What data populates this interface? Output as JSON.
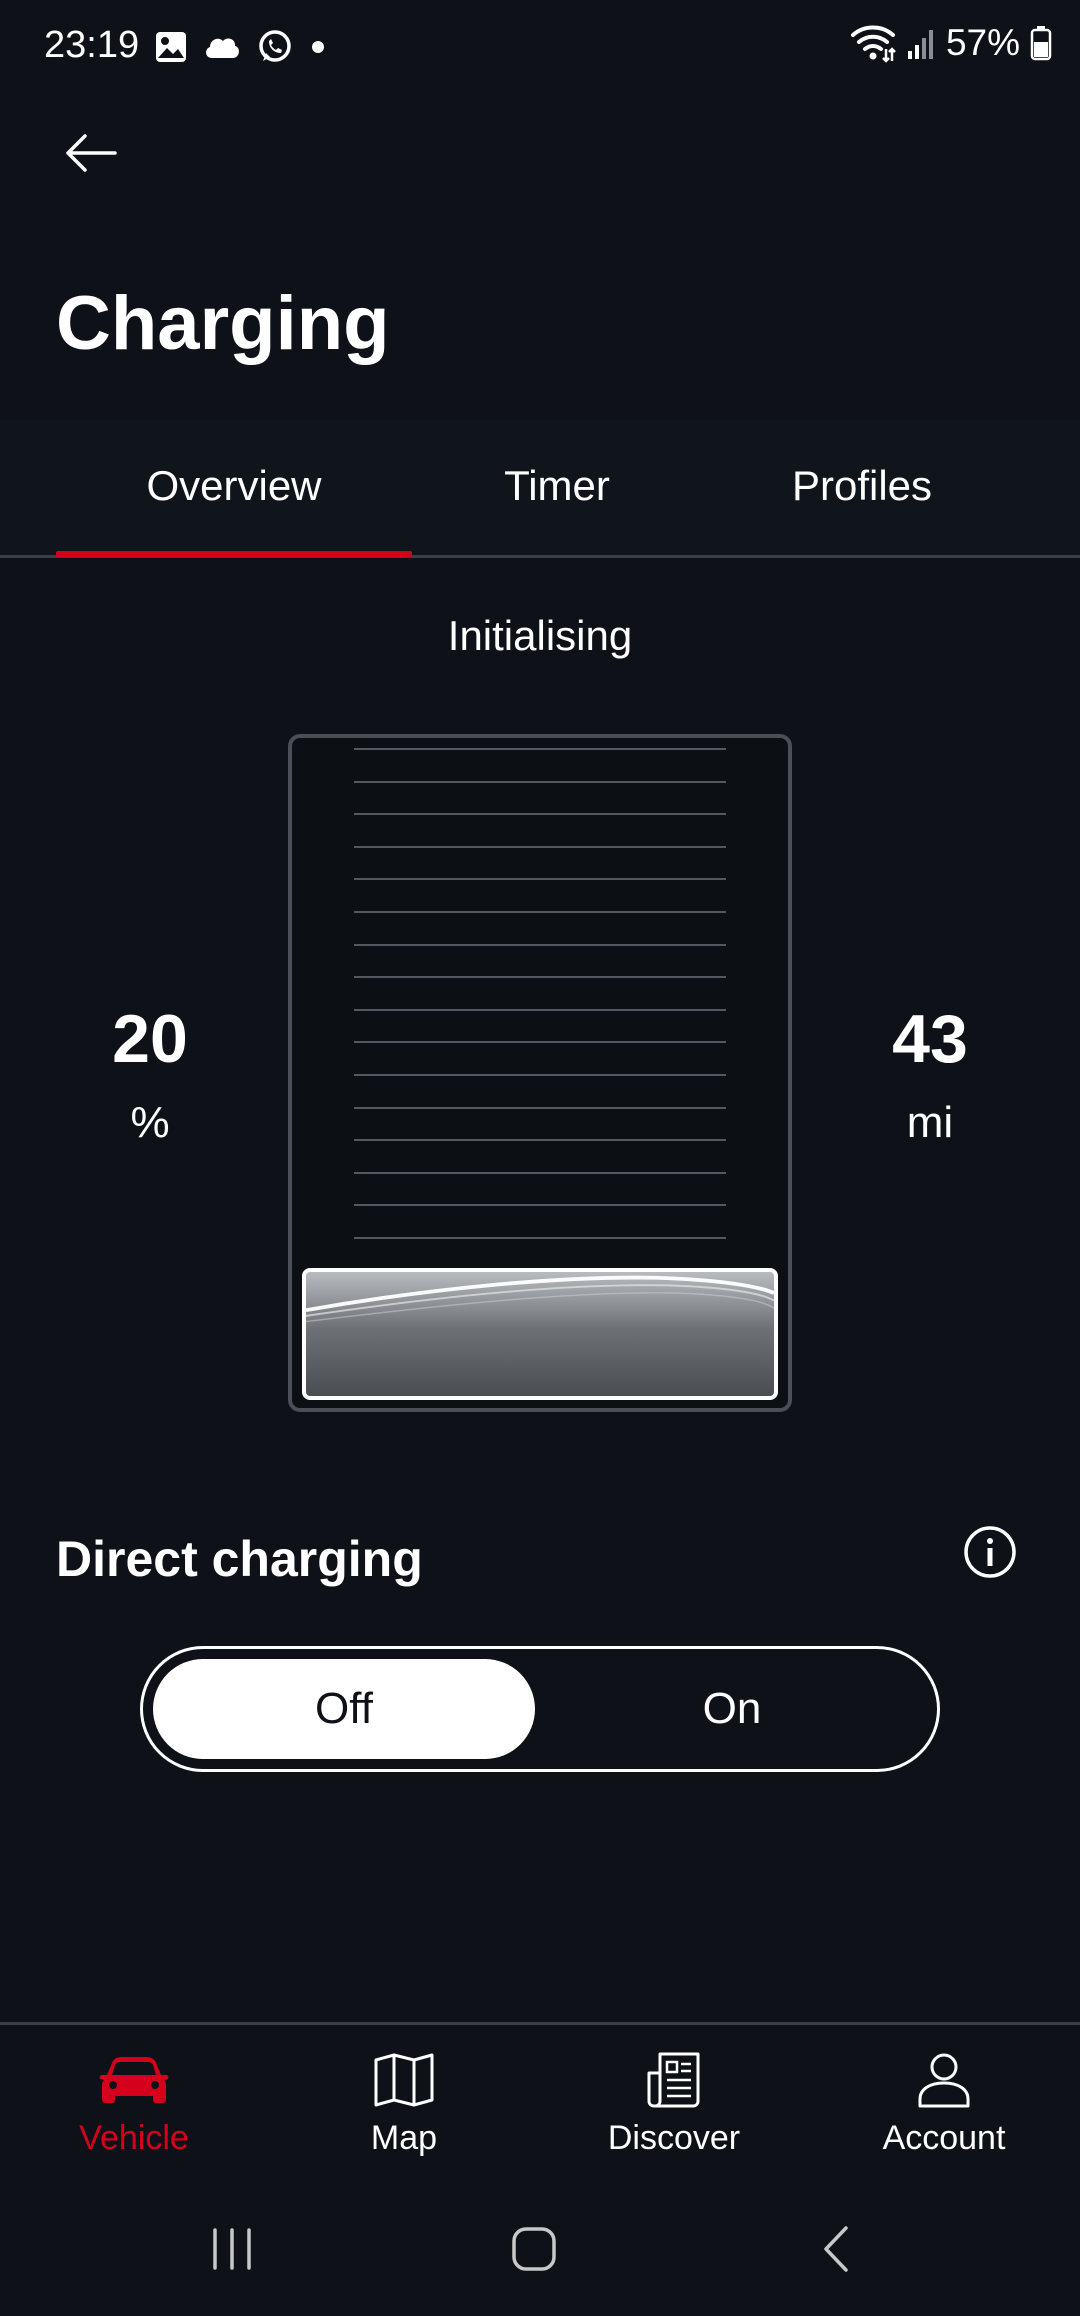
{
  "status_bar": {
    "time": "23:19",
    "battery_text": "57%",
    "icons": [
      "gallery-icon",
      "cloud-icon",
      "whatsapp-icon",
      "dot-icon",
      "wifi-icon",
      "signal-icon",
      "battery-icon"
    ]
  },
  "header": {
    "title": "Charging"
  },
  "tabs": [
    {
      "label": "Overview",
      "active": true
    },
    {
      "label": "Timer",
      "active": false
    },
    {
      "label": "Profiles",
      "active": false
    }
  ],
  "charging": {
    "status": "Initialising",
    "soc_value": "20",
    "soc_unit": "%",
    "range_value": "43",
    "range_unit": "mi",
    "fill_fraction": 0.2
  },
  "direct_charging": {
    "title": "Direct charging",
    "off_label": "Off",
    "on_label": "On",
    "selected": "Off"
  },
  "bottom_nav": [
    {
      "label": "Vehicle",
      "icon": "car-icon",
      "active": true
    },
    {
      "label": "Map",
      "icon": "map-icon",
      "active": false
    },
    {
      "label": "Discover",
      "icon": "newspaper-icon",
      "active": false
    },
    {
      "label": "Account",
      "icon": "person-icon",
      "active": false
    }
  ],
  "colors": {
    "background": "#0e1117",
    "accent": "#d5001c",
    "text": "#ffffff"
  }
}
